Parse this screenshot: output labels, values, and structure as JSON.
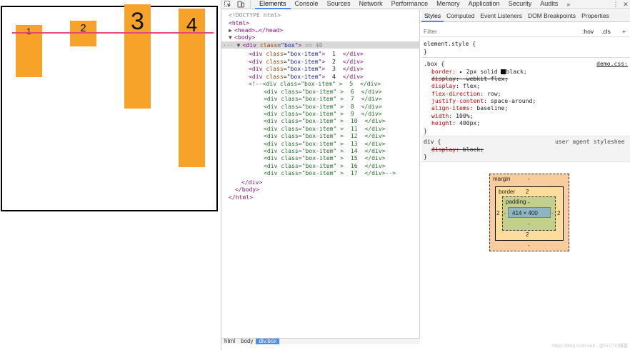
{
  "preview": {
    "items": [
      "1",
      "2",
      "3",
      "4"
    ]
  },
  "toolbar": {
    "tabs": [
      "Elements",
      "Console",
      "Sources",
      "Network",
      "Performance",
      "Memory",
      "Application",
      "Security",
      "Audits"
    ],
    "more": "»",
    "active_tab": "Elements"
  },
  "dom": {
    "doctype": "<!DOCTYPE html>",
    "html_open": "<html>",
    "head_collapsed": "<head>…</head>",
    "body_open": "<body>",
    "box_div": {
      "tag_open": "<div ",
      "attr": "class",
      "value": "\"box\"",
      "tag_close": ">",
      "suffix": " == $0"
    },
    "visible_items": [
      {
        "value": "\"box-item\"",
        "text": "  1  "
      },
      {
        "value": "\"box-item\"",
        "text": "  2  "
      },
      {
        "value": "\"box-item\"",
        "text": "  3  "
      },
      {
        "value": "\"box-item\"",
        "text": "  4  "
      }
    ],
    "comment_items": [
      {
        "prefix": "<!--<div class=\"box-item\" >  ",
        "num": "5",
        "suffix": "  </div>"
      },
      {
        "prefix": "<div class=\"box-item\" >  ",
        "num": "6",
        "suffix": "  </div>"
      },
      {
        "prefix": "<div class=\"box-item\" >  ",
        "num": "7",
        "suffix": "  </div>"
      },
      {
        "prefix": "<div class=\"box-item\" >  ",
        "num": "8",
        "suffix": "  </div>"
      },
      {
        "prefix": "<div class=\"box-item\" >  ",
        "num": "9",
        "suffix": "  </div>"
      },
      {
        "prefix": "<div class=\"box-item\" >  ",
        "num": "10",
        "suffix": "  </div>"
      },
      {
        "prefix": "<div class=\"box-item\" >  ",
        "num": "11",
        "suffix": "  </div>"
      },
      {
        "prefix": "<div class=\"box-item\" >  ",
        "num": "12",
        "suffix": "  </div>"
      },
      {
        "prefix": "<div class=\"box-item\" >  ",
        "num": "13",
        "suffix": "  </div>"
      },
      {
        "prefix": "<div class=\"box-item\" >  ",
        "num": "14",
        "suffix": "  </div>"
      },
      {
        "prefix": "<div class=\"box-item\" >  ",
        "num": "15",
        "suffix": "  </div>"
      },
      {
        "prefix": "<div class=\"box-item\" >  ",
        "num": "16",
        "suffix": "  </div>"
      },
      {
        "prefix": "<div class=\"box-item\" >  ",
        "num": "17",
        "suffix": "  </div>-->"
      }
    ],
    "div_close": "</div>",
    "body_close": "</body>",
    "html_close": "</html>",
    "breadcrumbs": [
      "html",
      "body",
      "div.box"
    ]
  },
  "styles": {
    "subtabs": [
      "Styles",
      "Computed",
      "Event Listeners",
      "DOM Breakpoints",
      "Properties"
    ],
    "filter_placeholder": "Filter",
    "hov": ":hov",
    "cls": ".cls",
    "add": "+",
    "element_style": "element.style {",
    "close_brace": "}",
    "box_rule": {
      "selector": ".box {",
      "source": "demo.css:",
      "border_prop": "border",
      "border_val": "▸ 2px solid ",
      "border_val2": "black;",
      "props": [
        {
          "name": "display",
          "value": "-webkit-flex;",
          "struck": true
        },
        {
          "name": "display",
          "value": "flex;",
          "struck": false
        },
        {
          "name": "flex-direction",
          "value": "row;",
          "struck": false
        },
        {
          "name": "justify-content",
          "value": "space-around;",
          "struck": false
        },
        {
          "name": "align-items",
          "value": "baseline;",
          "struck": false
        },
        {
          "name": "width",
          "value": "100%;",
          "struck": false
        },
        {
          "name": "height",
          "value": "400px;",
          "struck": false
        }
      ]
    },
    "ua_rule": {
      "selector": "div {",
      "source": "user agent styleshee",
      "prop": "display",
      "value": "block;"
    }
  },
  "box_model": {
    "margin_label": "margin",
    "margin_top": "-",
    "margin_bottom": "-",
    "border_label": "border",
    "border_top": "2",
    "border_bottom": "2",
    "border_left": "2",
    "border_right": "2",
    "padding_label": "padding",
    "padding_top": "-",
    "padding_bottom": "-",
    "padding_left": "-",
    "padding_right": "-",
    "content": "414 × 400"
  },
  "watermark": "https://blog.csdn.net/...@51CTO博客",
  "colors": {
    "box_item": "#f7a32a",
    "baseline_line": "#e8487a",
    "active_tab_underline": "#4a8af4"
  }
}
